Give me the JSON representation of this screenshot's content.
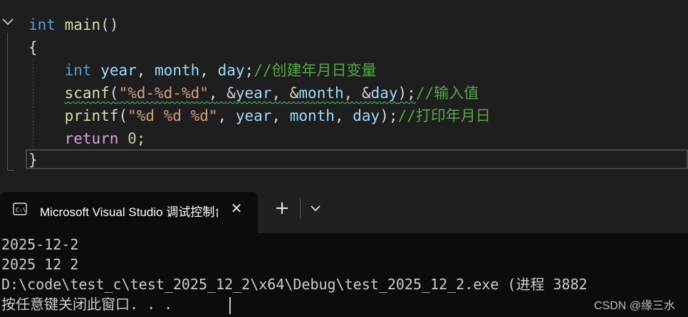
{
  "editor": {
    "lines": {
      "l1": {
        "kw": "int",
        "fn": "main",
        "paren": "()"
      },
      "l2": {
        "brace": "{"
      },
      "l3": {
        "kw": "int",
        "v1": "year",
        "c1": ",",
        "v2": "month",
        "c2": ",",
        "v3": "day",
        "semi": ";",
        "comment": "//创建年月日变量"
      },
      "l4": {
        "fn": "scanf",
        "open": "(",
        "fmt": "\"%d-%d-%d\"",
        "c1": ",",
        "a1": "&",
        "v1": "year",
        "c2": ",",
        "a2": "&",
        "v2": "month",
        "c3": ",",
        "a3": "&",
        "v3": "day",
        "close": ");",
        "comment": "//输入值"
      },
      "l5": {
        "fn": "printf",
        "open": "(",
        "fmt": "\"%d %d %d\"",
        "c1": ",",
        "v1": "year",
        "c2": ",",
        "v2": "month",
        "c3": ",",
        "v3": "day",
        "close": ");",
        "comment": "//打印年月日"
      },
      "l6": {
        "kw": "return",
        "num": "0",
        "semi": ";"
      },
      "l7": {
        "brace": "}"
      }
    },
    "colors": {
      "keyword": "#569cd6",
      "control": "#d8a0df",
      "function": "#dcdcaa",
      "variable": "#9cdcfe",
      "string": "#d69d85",
      "comment": "#57a64a",
      "number": "#b5cea8"
    }
  },
  "terminal": {
    "tab_title": "Microsoft Visual Studio 调试控制台",
    "tab_icon": "console-icon",
    "close_glyph": "✕",
    "new_tab_glyph": "+",
    "dropdown_icon": "chevron-down-icon",
    "output": [
      "2025-12-2",
      "2025 12 2",
      "D:\\code\\test_c\\test_2025_12_2\\x64\\Debug\\test_2025_12_2.exe (进程 3882",
      "按任意键关闭此窗口. . ."
    ]
  },
  "watermark": "CSDN @缘三水"
}
